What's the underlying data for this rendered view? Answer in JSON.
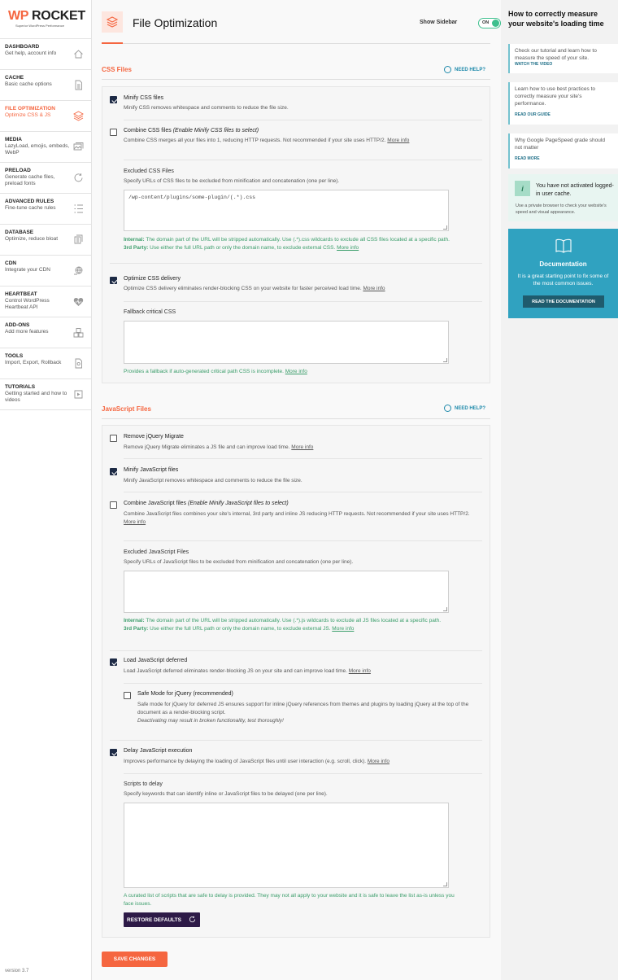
{
  "brand": {
    "logo_wp": "WP",
    "logo_rocket": "ROCKET",
    "tagline": "Superior WordPress Performance",
    "version": "version 3.7"
  },
  "nav": [
    {
      "title": "DASHBOARD",
      "sub": "Get help, account info",
      "icon": "home-icon"
    },
    {
      "title": "CACHE",
      "sub": "Basic cache options",
      "icon": "file-icon"
    },
    {
      "title": "FILE OPTIMIZATION",
      "sub": "Optimize CSS & JS",
      "icon": "layers-icon",
      "active": true
    },
    {
      "title": "MEDIA",
      "sub": "LazyLoad, emojis, embeds, WebP",
      "icon": "images-icon"
    },
    {
      "title": "PRELOAD",
      "sub": "Generate cache files, preload fonts",
      "icon": "refresh-icon"
    },
    {
      "title": "ADVANCED RULES",
      "sub": "Fine-tune cache rules",
      "icon": "list-icon"
    },
    {
      "title": "DATABASE",
      "sub": "Optimize, reduce bloat",
      "icon": "database-icon"
    },
    {
      "title": "CDN",
      "sub": "Integrate your CDN",
      "icon": "cdn-icon"
    },
    {
      "title": "HEARTBEAT",
      "sub": "Control WordPress Heartbeat API",
      "icon": "heartbeat-icon"
    },
    {
      "title": "ADD-ONS",
      "sub": "Add more features",
      "icon": "addons-icon"
    },
    {
      "title": "TOOLS",
      "sub": "Import, Export, Rollback",
      "icon": "tools-icon"
    },
    {
      "title": "TUTORIALS",
      "sub": "Getting started and how to videos",
      "icon": "video-icon"
    }
  ],
  "header": {
    "title": "File Optimization",
    "sidebar_label": "Show Sidebar",
    "toggle_state": "ON"
  },
  "need_help": "NEED HELP?",
  "css": {
    "title": "CSS Files",
    "minify": {
      "label": "Minify CSS files",
      "desc": "Minify CSS removes whitespace and comments to reduce the file size.",
      "checked": true
    },
    "combine": {
      "label": "Combine CSS files ",
      "label_em": "(Enable Minify CSS files to select)",
      "desc": "Combine CSS merges all your files into 1, reducing HTTP requests. Not recommended if your site uses HTTP/2. ",
      "more": "More info",
      "checked": false
    },
    "excluded": {
      "label": "Excluded CSS Files",
      "desc": "Specify URLs of CSS files to be excluded from minification and concatenation (one per line).",
      "value": "/wp-content/plugins/some-plugin/(.*).css",
      "note_internal_label": "Internal:",
      "note_internal": " The domain part of the URL will be stripped automatically. Use (.*).css wildcards to exclude all CSS files located at a specific path.",
      "note_3rd_label": "3rd Party:",
      "note_3rd": " Use either the full URL path or only the domain name, to exclude external CSS. ",
      "more": "More info"
    },
    "optimize": {
      "label": "Optimize CSS delivery",
      "desc": "Optimize CSS delivery eliminates render-blocking CSS on your website for faster perceived load time. ",
      "more": "More info",
      "checked": true
    },
    "fallback": {
      "label": "Fallback critical CSS",
      "note": "Provides a fallback if auto-generated critical path CSS is incomplete. ",
      "more": "More info"
    }
  },
  "js": {
    "title": "JavaScript Files",
    "remove_jquery": {
      "label": "Remove jQuery Migrate",
      "desc": "Remove jQuery Migrate eliminates a JS file and can improve load time. ",
      "more": "More info",
      "checked": false
    },
    "minify": {
      "label": "Minify JavaScript files",
      "desc": "Minify JavaScript removes whitespace and comments to reduce the file size.",
      "checked": true
    },
    "combine": {
      "label": "Combine JavaScript files ",
      "label_em": "(Enable Minify JavaScript files to select)",
      "desc": "Combine JavaScript files combines your site's internal, 3rd party and inline JS reducing HTTP requests. Not recommended if your site uses HTTP/2. ",
      "more": "More info",
      "checked": false
    },
    "excluded": {
      "label": "Excluded JavaScript Files",
      "desc": "Specify URLs of JavaScript files to be excluded from minification and concatenation (one per line).",
      "note_internal_label": "Internal:",
      "note_internal": " The domain part of the URL will be stripped automatically. Use (.*).js wildcards to exclude all JS files located at a specific path.",
      "note_3rd_label": "3rd Party:",
      "note_3rd": " Use either the full URL path or only the domain name, to exclude external JS. ",
      "more": "More info"
    },
    "deferred": {
      "label": "Load JavaScript deferred",
      "desc": "Load JavaScript deferred eliminates render-blocking JS on your site and can improve load time. ",
      "more": "More info",
      "checked": true
    },
    "safe_mode": {
      "label": "Safe Mode for jQuery (recommended)",
      "desc": "Safe mode for jQuery for deferred JS ensures support for inline jQuery references from themes and plugins by loading jQuery at the top of the document as a render-blocking script.",
      "warn": "Deactivating may result in broken functionality, test thoroughly!",
      "checked": false
    },
    "delay": {
      "label": "Delay JavaScript execution",
      "desc": "Improves performance by delaying the loading of JavaScript files until user interaction (e.g. scroll, click). ",
      "more": "More info",
      "checked": true
    },
    "scripts": {
      "label": "Scripts to delay",
      "desc": "Specify keywords that can identify inline or JavaScript files to be delayed (one per line).",
      "note": "A curated list of scripts that are safe to delay is provided. They may not all apply to your website and it is safe to leave the list as-is unless you face issues."
    },
    "restore": "RESTORE DEFAULTS"
  },
  "save": "SAVE CHANGES",
  "right": {
    "title": "How to correctly measure your website's loading time",
    "card1": {
      "text": "Check our tutorial and learn how to measure the speed of your site.",
      "link": "WATCH THE VIDEO"
    },
    "card2": {
      "text": "Learn how to use best practices to correctly measure your site's performance.",
      "link": "READ OUR GUIDE"
    },
    "card3": {
      "text": "Why Google PageSpeed grade should not matter",
      "link": "READ MORE"
    },
    "cache": {
      "icon": "i",
      "title": "You have not activated logged-in user cache.",
      "desc": "Use a private browser to check your website's speed and visual appearance."
    },
    "doc": {
      "title": "Documentation",
      "desc": "It is a great starting point to fix some of the most common issues.",
      "button": "READ THE DOCUMENTATION"
    }
  },
  "colors": {
    "accent": "#f56640",
    "teal": "#30a2c0",
    "green": "#3ec08e",
    "navy": "#2d1a47"
  }
}
